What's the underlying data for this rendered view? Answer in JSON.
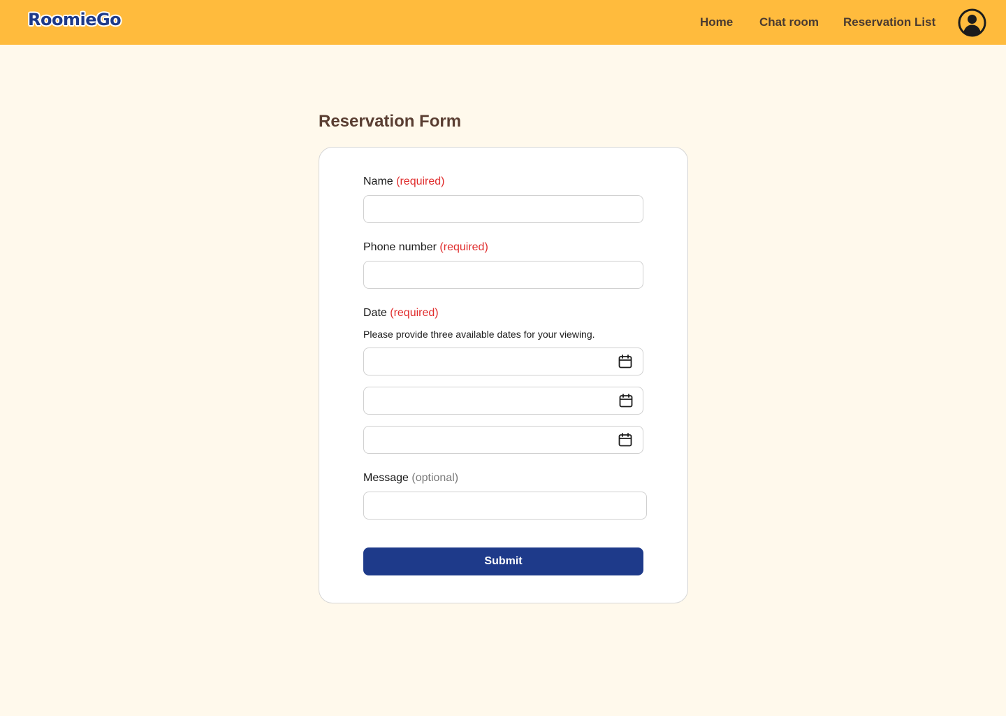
{
  "header": {
    "logo": "RoomieGo",
    "nav": [
      "Home",
      "Chat room",
      "Reservation List"
    ],
    "avatar_icon": "user-circle-icon",
    "background_color": "#ffbb3d"
  },
  "form": {
    "title": "Reservation Form",
    "name": {
      "label": "Name",
      "tag": "(required)",
      "value": ""
    },
    "phone": {
      "label": "Phone number",
      "tag": "(required)",
      "value": ""
    },
    "date": {
      "label": "Date",
      "tag": "(required)",
      "hint": "Please provide three available dates for your viewing.",
      "values": [
        "",
        "",
        ""
      ],
      "icon": "calendar-icon"
    },
    "message": {
      "label": "Message",
      "tag": "(optional)",
      "value": ""
    },
    "submit_label": "Submit",
    "accent_color": "#1e3a8a",
    "required_color": "#e02d2d"
  }
}
